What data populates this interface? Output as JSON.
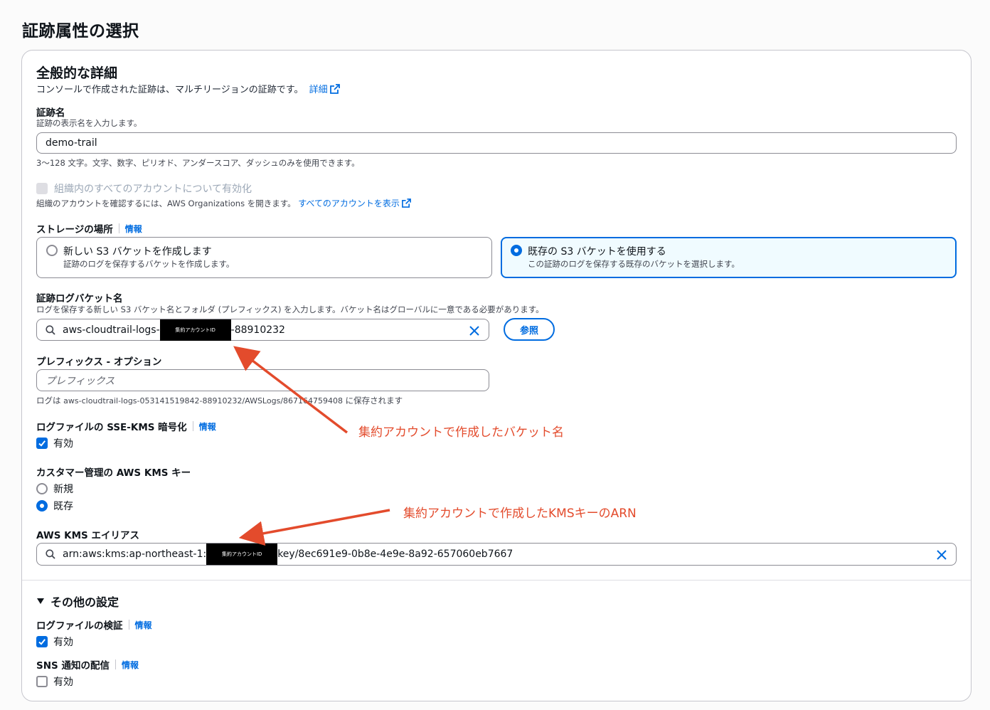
{
  "page_title": "証跡属性の選択",
  "general": {
    "heading": "全般的な詳細",
    "description": "コンソールで作成された証跡は、マルチリージョンの証跡です。",
    "details_link": "詳細"
  },
  "trail_name": {
    "label": "証跡名",
    "description": "証跡の表示名を入力します。",
    "value": "demo-trail",
    "constraint": "3〜128 文字。文字、数字、ピリオド、アンダースコア、ダッシュのみを使用できます。"
  },
  "organization": {
    "checkbox_label": "組織内のすべてのアカウントについて有効化",
    "note": "組織のアカウントを確認するには、AWS Organizations を開きます。",
    "link": "すべてのアカウントを表示"
  },
  "storage": {
    "label": "ストレージの場所",
    "info": "情報",
    "options": [
      {
        "title": "新しい S3 バケットを作成します",
        "desc": "証跡のログを保存するバケットを作成します。",
        "selected": false
      },
      {
        "title": "既存の S3 バケットを使用する",
        "desc": "この証跡のログを保存する既存のバケットを選択します。",
        "selected": true
      }
    ]
  },
  "bucket": {
    "label": "証跡ログバケット名",
    "description": "ログを保存する新しい S3 バケット名とフォルダ (プレフィックス) を入力します。バケット名はグローバルに一意である必要があります。",
    "value_prefix": "aws-cloudtrail-logs-",
    "redaction_text": "集約アカウントID",
    "value_suffix": "-88910232",
    "browse_button": "参照"
  },
  "prefix": {
    "label": "プレフィックス - オプション",
    "placeholder": "プレフィックス",
    "note_pre": "ログは",
    "note_path": "aws-cloudtrail-logs-053141519842-88910232/AWSLogs/867164759408",
    "note_post": "に保存されます"
  },
  "sse_kms": {
    "label": "ログファイルの SSE-KMS 暗号化",
    "info": "情報",
    "checkbox_label": "有効",
    "checked": true
  },
  "cmk": {
    "label": "カスタマー管理の AWS KMS キー",
    "options": [
      {
        "label": "新規",
        "selected": false
      },
      {
        "label": "既存",
        "selected": true
      }
    ]
  },
  "kms_alias": {
    "label": "AWS KMS エイリアス",
    "value_prefix": "arn:aws:kms:ap-northeast-1:",
    "redaction_text": "集約アカウントID",
    "value_suffix": "key/8ec691e9-0b8e-4e9e-8a92-657060eb7667"
  },
  "other": {
    "heading": "その他の設定",
    "validation": {
      "label": "ログファイルの検証",
      "info": "情報",
      "checkbox_label": "有効",
      "checked": true
    },
    "sns": {
      "label": "SNS 通知の配信",
      "info": "情報",
      "checkbox_label": "有効",
      "checked": false
    }
  },
  "annotations": {
    "bucket_note": "集約アカウントで作成したバケット名",
    "kms_note": "集約アカウントで作成したKMSキーのARN",
    "color": "#e34b2c"
  },
  "colors": {
    "accent": "#006ce0",
    "annotation": "#e34b2c"
  }
}
